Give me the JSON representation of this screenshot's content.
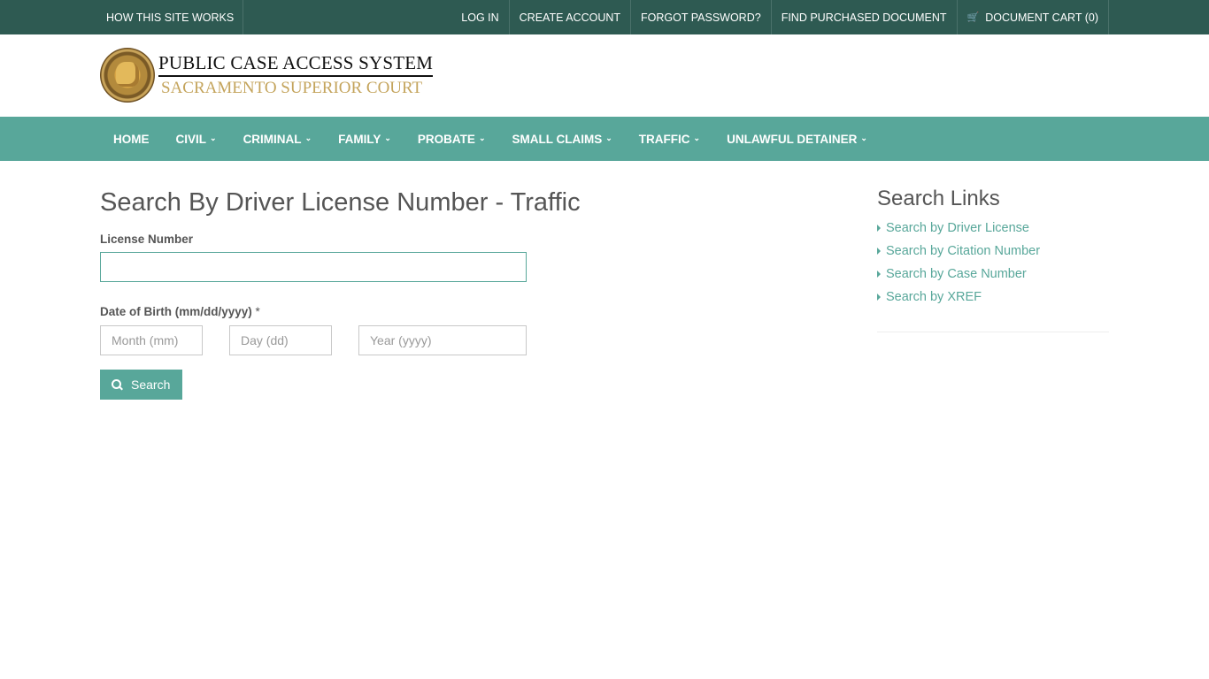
{
  "topbar": {
    "left": [
      "HOW THIS SITE WORKS"
    ],
    "right": {
      "login": "LOG IN",
      "create_account": "CREATE ACCOUNT",
      "forgot_password": "FORGOT PASSWORD?",
      "find_document": "FIND PURCHASED DOCUMENT",
      "cart": "DOCUMENT CART (0)"
    }
  },
  "header": {
    "title": "PUBLIC CASE ACCESS SYSTEM",
    "subtitle": "SACRAMENTO SUPERIOR COURT"
  },
  "nav": {
    "items": [
      "HOME",
      "CIVIL",
      "CRIMINAL",
      "FAMILY",
      "PROBATE",
      "SMALL CLAIMS",
      "TRAFFIC",
      "UNLAWFUL DETAINER"
    ]
  },
  "form": {
    "title": "Search By Driver License Number - Traffic",
    "license_label": "License Number",
    "license_value": "",
    "dob_label": "Date of Birth (mm/dd/yyyy)",
    "dob_required": "*",
    "month_placeholder": "Month (mm)",
    "day_placeholder": "Day (dd)",
    "year_placeholder": "Year (yyyy)",
    "search_label": "Search"
  },
  "sidebar": {
    "title": "Search Links",
    "links": [
      "Search by Driver License",
      "Search by Citation Number",
      "Search by Case Number",
      "Search by XREF"
    ]
  },
  "colors": {
    "topbar_bg": "#2e5a52",
    "accent": "#58a79a",
    "logo_subtitle": "#c4a45c"
  }
}
